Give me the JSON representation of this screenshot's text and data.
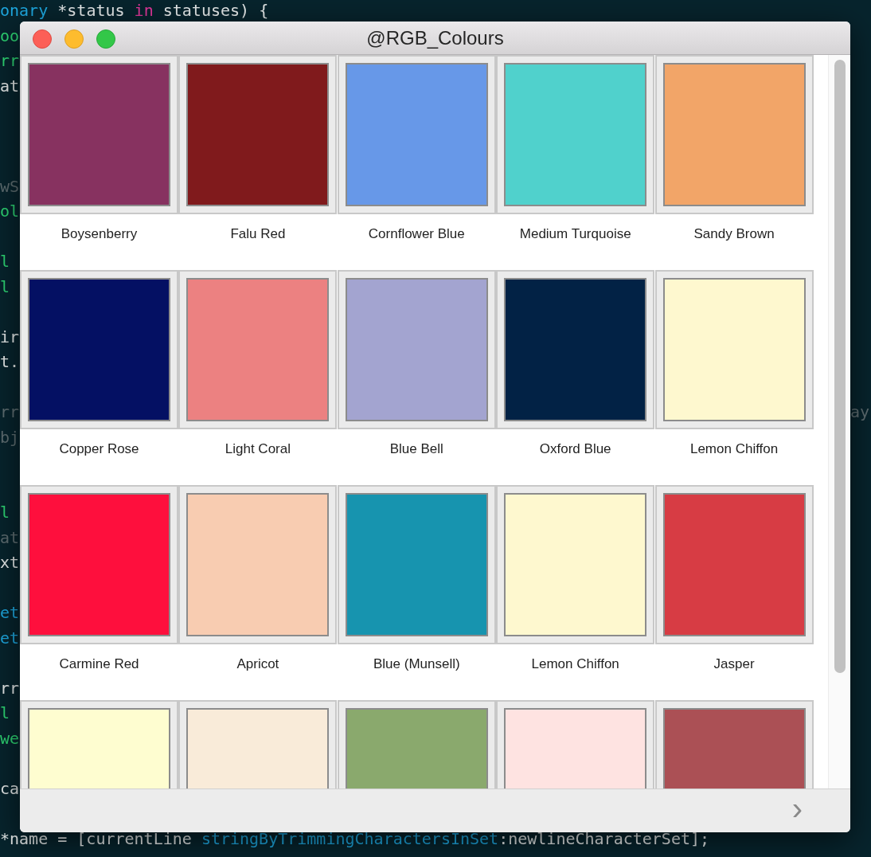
{
  "editor": {
    "lines": [
      {
        "kind": "code",
        "segments": [
          {
            "text": "onary",
            "kind": "type"
          },
          {
            "text": " *status ",
            "kind": "plain"
          },
          {
            "text": "in",
            "kind": "keyword"
          },
          {
            "text": " statuses) {",
            "kind": "plain"
          }
        ]
      },
      {
        "kind": "code",
        "segments": [
          {
            "text": "oo",
            "kind": "name"
          }
        ]
      },
      {
        "kind": "code",
        "segments": [
          {
            "text": "rr",
            "kind": "name"
          }
        ]
      },
      {
        "kind": "code",
        "segments": [
          {
            "text": "at",
            "kind": "plain"
          }
        ]
      },
      {
        "kind": "blank"
      },
      {
        "kind": "blank"
      },
      {
        "kind": "blank"
      },
      {
        "kind": "code",
        "segments": [
          {
            "text": "wS",
            "kind": "comment"
          }
        ]
      },
      {
        "kind": "code",
        "segments": [
          {
            "text": "ol",
            "kind": "name"
          }
        ]
      },
      {
        "kind": "blank"
      },
      {
        "kind": "code",
        "segments": [
          {
            "text": "l",
            "kind": "name"
          }
        ]
      },
      {
        "kind": "code",
        "segments": [
          {
            "text": "l",
            "kind": "name"
          }
        ]
      },
      {
        "kind": "blank"
      },
      {
        "kind": "code",
        "segments": [
          {
            "text": "ir",
            "kind": "plain"
          }
        ]
      },
      {
        "kind": "code",
        "segments": [
          {
            "text": "t.",
            "kind": "plain"
          }
        ]
      },
      {
        "kind": "blank"
      },
      {
        "kind": "code",
        "segments": [
          {
            "text": "rr",
            "kind": "comment"
          }
        ],
        "right": "ay"
      },
      {
        "kind": "code",
        "segments": [
          {
            "text": "bj",
            "kind": "comment"
          }
        ]
      },
      {
        "kind": "blank"
      },
      {
        "kind": "blank"
      },
      {
        "kind": "code",
        "segments": [
          {
            "text": "l",
            "kind": "name"
          }
        ]
      },
      {
        "kind": "code",
        "segments": [
          {
            "text": "at",
            "kind": "comment"
          }
        ]
      },
      {
        "kind": "code",
        "segments": [
          {
            "text": "xt",
            "kind": "plain"
          }
        ]
      },
      {
        "kind": "blank"
      },
      {
        "kind": "code",
        "segments": [
          {
            "text": "et",
            "kind": "type"
          }
        ]
      },
      {
        "kind": "code",
        "segments": [
          {
            "text": "et",
            "kind": "type"
          }
        ]
      },
      {
        "kind": "blank"
      },
      {
        "kind": "code",
        "segments": [
          {
            "text": "rr",
            "kind": "plain"
          }
        ]
      },
      {
        "kind": "code",
        "segments": [
          {
            "text": "l",
            "kind": "name"
          }
        ]
      },
      {
        "kind": "code",
        "segments": [
          {
            "text": "we",
            "kind": "name"
          }
        ]
      },
      {
        "kind": "blank"
      },
      {
        "kind": "code",
        "segments": [
          {
            "text": "ca",
            "kind": "plain"
          }
        ]
      },
      {
        "kind": "blank"
      },
      {
        "kind": "code",
        "segments": [
          {
            "text": "*name = [currentLine ",
            "kind": "plain"
          },
          {
            "text": "stringByTrimmingCharactersInSet",
            "kind": "type"
          },
          {
            "text": ":newlineCharacterSet];",
            "kind": "plain"
          }
        ]
      }
    ]
  },
  "window": {
    "title": "@RGB_Colours"
  },
  "swatches": [
    {
      "name": "Boysenberry",
      "color": "#873260"
    },
    {
      "name": "Falu Red",
      "color": "#801a1c"
    },
    {
      "name": "Cornflower Blue",
      "color": "#6798e8"
    },
    {
      "name": "Medium Turquoise",
      "color": "#50d1cc"
    },
    {
      "name": "Sandy Brown",
      "color": "#f2a568"
    },
    {
      "name": "Copper Rose",
      "color": "#041063"
    },
    {
      "name": "Light Coral",
      "color": "#ec8181"
    },
    {
      "name": "Blue Bell",
      "color": "#a3a4d0"
    },
    {
      "name": "Oxford Blue",
      "color": "#022245"
    },
    {
      "name": "Lemon Chiffon",
      "color": "#fef8cf"
    },
    {
      "name": "Carmine Red",
      "color": "#fe0f3d"
    },
    {
      "name": "Apricot",
      "color": "#f8ccb1"
    },
    {
      "name": "Blue (Munsell)",
      "color": "#1794af"
    },
    {
      "name": "Lemon Chiffon",
      "color": "#fef8cf"
    },
    {
      "name": "Jasper",
      "color": "#d73c44"
    },
    {
      "color": "#fefdd0"
    },
    {
      "color": "#f9ebd9"
    },
    {
      "color": "#8aa96d"
    },
    {
      "color": "#fee3e1"
    },
    {
      "color": "#ab5055"
    }
  ],
  "footer": {
    "next": "›"
  }
}
